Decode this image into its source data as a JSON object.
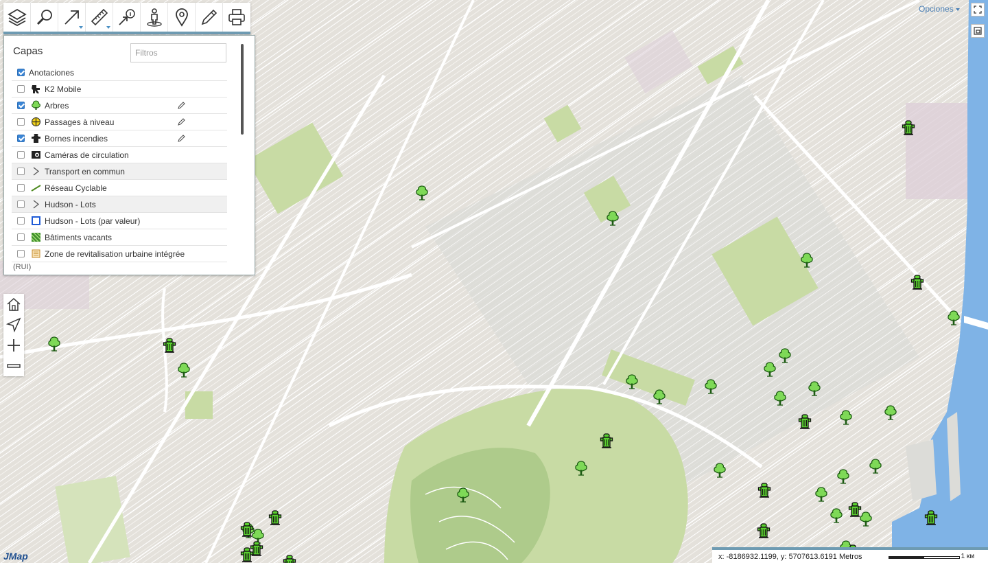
{
  "toolbar": {
    "tools": [
      {
        "name": "layers-tool",
        "icon": "layers-icon"
      },
      {
        "name": "search-tool",
        "icon": "magnifier-icon"
      },
      {
        "name": "arrow-tool",
        "icon": "arrow-icon"
      },
      {
        "name": "measure-tool",
        "icon": "ruler-icon"
      },
      {
        "name": "info-tool",
        "icon": "info-pointer-icon"
      },
      {
        "name": "streetview-tool",
        "icon": "person-icon"
      },
      {
        "name": "location-tool",
        "icon": "pin-icon"
      },
      {
        "name": "draw-tool",
        "icon": "pencil-icon"
      },
      {
        "name": "print-tool",
        "icon": "printer-icon"
      }
    ]
  },
  "layers_panel": {
    "title": "Capas",
    "filter_placeholder": "Filtros",
    "items": [
      {
        "label": "Anotaciones",
        "checked": true,
        "icon": "none",
        "editable": false,
        "shaded": false
      },
      {
        "label": "K2 Mobile",
        "checked": false,
        "icon": "k2-icon",
        "editable": false,
        "shaded": false
      },
      {
        "label": "Arbres",
        "checked": true,
        "icon": "tree-icon",
        "editable": true,
        "shaded": false
      },
      {
        "label": "Passages à niveau",
        "checked": false,
        "icon": "crossing-icon",
        "editable": true,
        "shaded": false
      },
      {
        "label": "Bornes incendies",
        "checked": true,
        "icon": "hydrant-icon",
        "editable": true,
        "shaded": false
      },
      {
        "label": "Caméras de circulation",
        "checked": false,
        "icon": "camera-icon",
        "editable": false,
        "shaded": false
      },
      {
        "label": "Transport en commun",
        "checked": false,
        "icon": "group-arrow-icon",
        "editable": false,
        "shaded": true
      },
      {
        "label": "Réseau Cyclable",
        "checked": false,
        "icon": "line-icon",
        "editable": false,
        "shaded": false
      },
      {
        "label": "Hudson - Lots",
        "checked": false,
        "icon": "group-arrow-icon",
        "editable": false,
        "shaded": true
      },
      {
        "label": "Hudson - Lots (par valeur)",
        "checked": false,
        "icon": "square-icon",
        "editable": false,
        "shaded": false
      },
      {
        "label": "Bâtiments vacants",
        "checked": false,
        "icon": "hatch-icon",
        "editable": false,
        "shaded": false
      },
      {
        "label": "Zone de revitalisation urbaine intégrée",
        "checked": false,
        "icon": "zone-icon",
        "editable": false,
        "shaded": false
      }
    ],
    "wrap_text": "(RUI)"
  },
  "options_link": "Opciones",
  "logo": "JMap",
  "status": {
    "coordinates": "x: -8186932.1199, y: 5707613.6191 Metros",
    "scale_unit": "1 км"
  },
  "colors": {
    "accent": "#6e9bb2",
    "tree_green": "#7ed957",
    "hydrant_green": "#5ad12f",
    "water": "#7fb3e6",
    "park": "#c8dba4"
  }
}
